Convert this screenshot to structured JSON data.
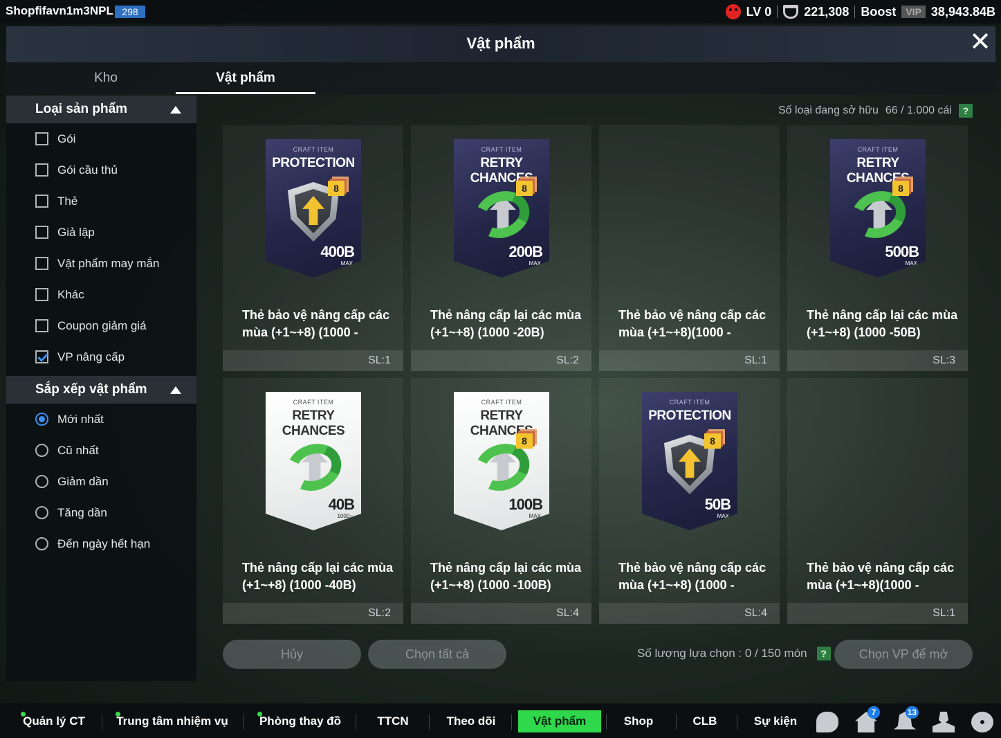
{
  "topbar": {
    "username": "Shopfifavn1m3NPL",
    "user_level": "298",
    "lv": "LV 0",
    "trophies": "221,308",
    "boost_label": "Boost",
    "vip_label": "VIP",
    "balance": "38,943.84B"
  },
  "header": {
    "title": "Vật phẩm"
  },
  "tabs": [
    {
      "label": "Kho"
    },
    {
      "label": "Vật phẩm"
    }
  ],
  "sidebar": {
    "filter_title": "Loại sản phẩm",
    "filters": [
      {
        "label": "Gói",
        "checked": false
      },
      {
        "label": "Gói cầu thủ",
        "checked": false
      },
      {
        "label": "Thẻ",
        "checked": false
      },
      {
        "label": "Giả lập",
        "checked": false
      },
      {
        "label": "Vật phẩm may mắn",
        "checked": false
      },
      {
        "label": "Khác",
        "checked": false
      },
      {
        "label": "Coupon giảm giá",
        "checked": false
      },
      {
        "label": "VP nâng cấp",
        "checked": true
      }
    ],
    "sort_title": "Sắp xếp vật phẩm",
    "sorts": [
      {
        "label": "Mới nhất",
        "selected": true
      },
      {
        "label": "Cũ nhất",
        "selected": false
      },
      {
        "label": "Giảm dần",
        "selected": false
      },
      {
        "label": "Tăng dần",
        "selected": false
      },
      {
        "label": "Đến ngày hết hạn",
        "selected": false
      }
    ]
  },
  "owned": {
    "label": "Số loại đang sở hữu",
    "value": "66 / 1.000 cái",
    "help": "?"
  },
  "items": [
    {
      "name": "Thẻ bảo vệ nâng cấp các mùa (+1~+8) (1000 -",
      "qty": "SL:1",
      "art": {
        "style": "dark",
        "kind": "protection",
        "craft": "CRAFT ITEM",
        "title": "PROTECTION",
        "level": "8",
        "value": "400B",
        "sub": "MAX"
      }
    },
    {
      "name": "Thẻ nâng cấp lại các mùa (+1~+8) (1000 -20B)",
      "qty": "SL:2",
      "art": {
        "style": "dark",
        "kind": "retry",
        "craft": "CRAFT ITEM",
        "title": "RETRY CHANCES",
        "level": "8",
        "value": "200B",
        "sub": "MAX"
      }
    },
    {
      "name": "Thẻ bảo vệ nâng cấp các mùa (+1~+8)(1000 -",
      "qty": "SL:1",
      "art": null
    },
    {
      "name": "Thẻ nâng cấp lại các mùa (+1~+8) (1000 -50B)",
      "qty": "SL:3",
      "art": {
        "style": "dark",
        "kind": "retry",
        "craft": "CRAFT ITEM",
        "title": "RETRY CHANCES",
        "level": "8",
        "value": "500B",
        "sub": "MAX"
      }
    },
    {
      "name": "Thẻ nâng cấp lại các mùa (+1~+8) (1000 -40B)",
      "qty": "SL:2",
      "art": {
        "style": "light",
        "kind": "retry",
        "craft": "CRAFT ITEM",
        "title": "RETRY CHANCES",
        "level": "",
        "value": "40B",
        "sub": "1000~"
      }
    },
    {
      "name": "Thẻ nâng cấp lại các mùa (+1~+8) (1000 -100B)",
      "qty": "SL:4",
      "art": {
        "style": "light",
        "kind": "retry",
        "craft": "CRAFT ITEM",
        "title": "RETRY CHANCES",
        "level": "8",
        "value": "100B",
        "sub": "MAX"
      }
    },
    {
      "name": "Thẻ bảo vệ nâng cấp các mùa (+1~+8) (1000 -",
      "qty": "SL:4",
      "art": {
        "style": "dark",
        "kind": "protection",
        "craft": "CRAFT ITEM",
        "title": "PROTECTION",
        "level": "8",
        "value": "50B",
        "sub": "MAX"
      }
    },
    {
      "name": "Thẻ bảo vệ nâng cấp các mùa (+1~+8)(1000 -",
      "qty": "SL:1",
      "art": null
    }
  ],
  "actions": {
    "cancel": "Hủy",
    "select_all": "Chọn tất cả",
    "selected_label": "Số lượng lựa chọn : 0 / 150 món",
    "help": "?",
    "open": "Chọn VP để mở"
  },
  "nav": {
    "items": [
      {
        "label": "Quản lý CT",
        "dot": true,
        "active": false
      },
      {
        "label": "Trung tâm nhiệm vụ",
        "dot": true,
        "active": false
      },
      {
        "label": "Phòng thay đồ",
        "dot": true,
        "active": false
      },
      {
        "label": "TTCN",
        "dot": false,
        "active": false
      },
      {
        "label": "Theo dõi",
        "dot": false,
        "active": false
      },
      {
        "label": "Vật phẩm",
        "dot": false,
        "active": true
      },
      {
        "label": "Shop",
        "dot": false,
        "active": false
      },
      {
        "label": "CLB",
        "dot": false,
        "active": false
      },
      {
        "label": "Sự kiện",
        "dot": false,
        "active": false
      }
    ],
    "home_badge": "7",
    "bell_badge": "13"
  },
  "colors": {
    "accent_green": "#2ed84a",
    "check_blue": "#3e8ef0",
    "level_blue": "#2d6fc2"
  }
}
